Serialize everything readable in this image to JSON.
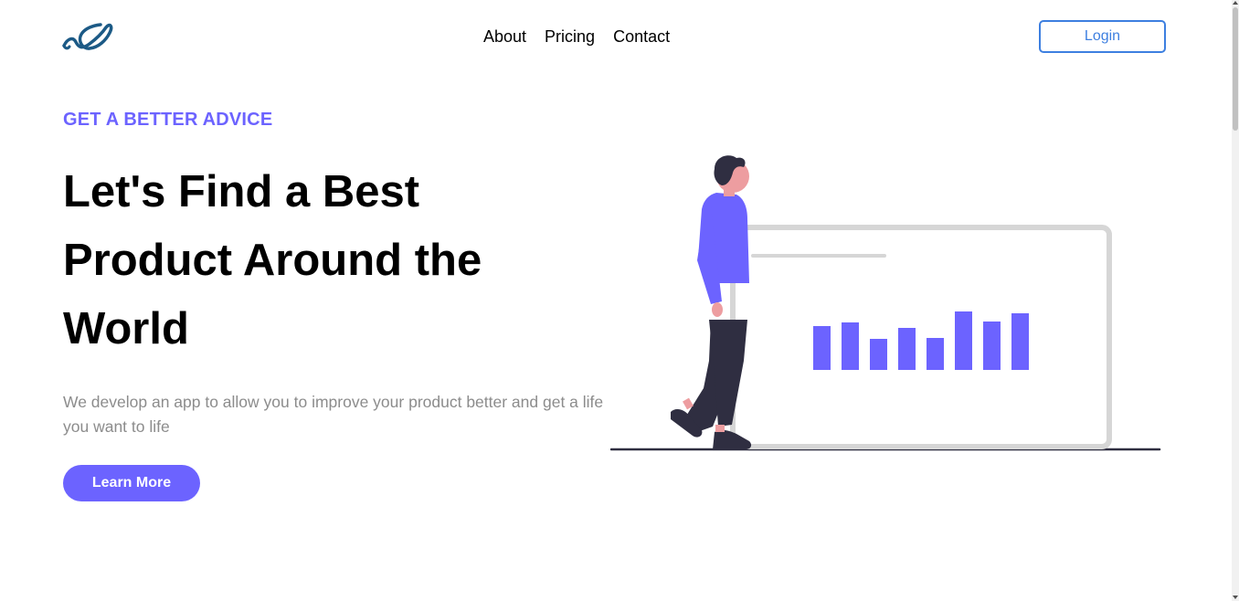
{
  "header": {
    "logo_icon": "fish-hook-logo-icon",
    "nav": [
      {
        "label": "About"
      },
      {
        "label": "Pricing"
      },
      {
        "label": "Contact"
      }
    ],
    "login_label": "Login"
  },
  "hero": {
    "eyebrow": "GET A BETTER ADVICE",
    "headline": "Let's Find a Best Product Around the World",
    "subtext": "We develop an app to allow you to improve your product better and get a life you want to life",
    "cta_label": "Learn More",
    "illustration_icon": "person-with-bar-chart-illustration",
    "chart_bar_levels": [
      0.75,
      0.81,
      0.53,
      0.72,
      0.55,
      1.0,
      0.83,
      0.97
    ]
  },
  "colors": {
    "accent": "#6c63ff",
    "login_blue": "#3d7fe0",
    "muted_text": "#8c8c8c",
    "logo_blue": "#1c5a86"
  }
}
